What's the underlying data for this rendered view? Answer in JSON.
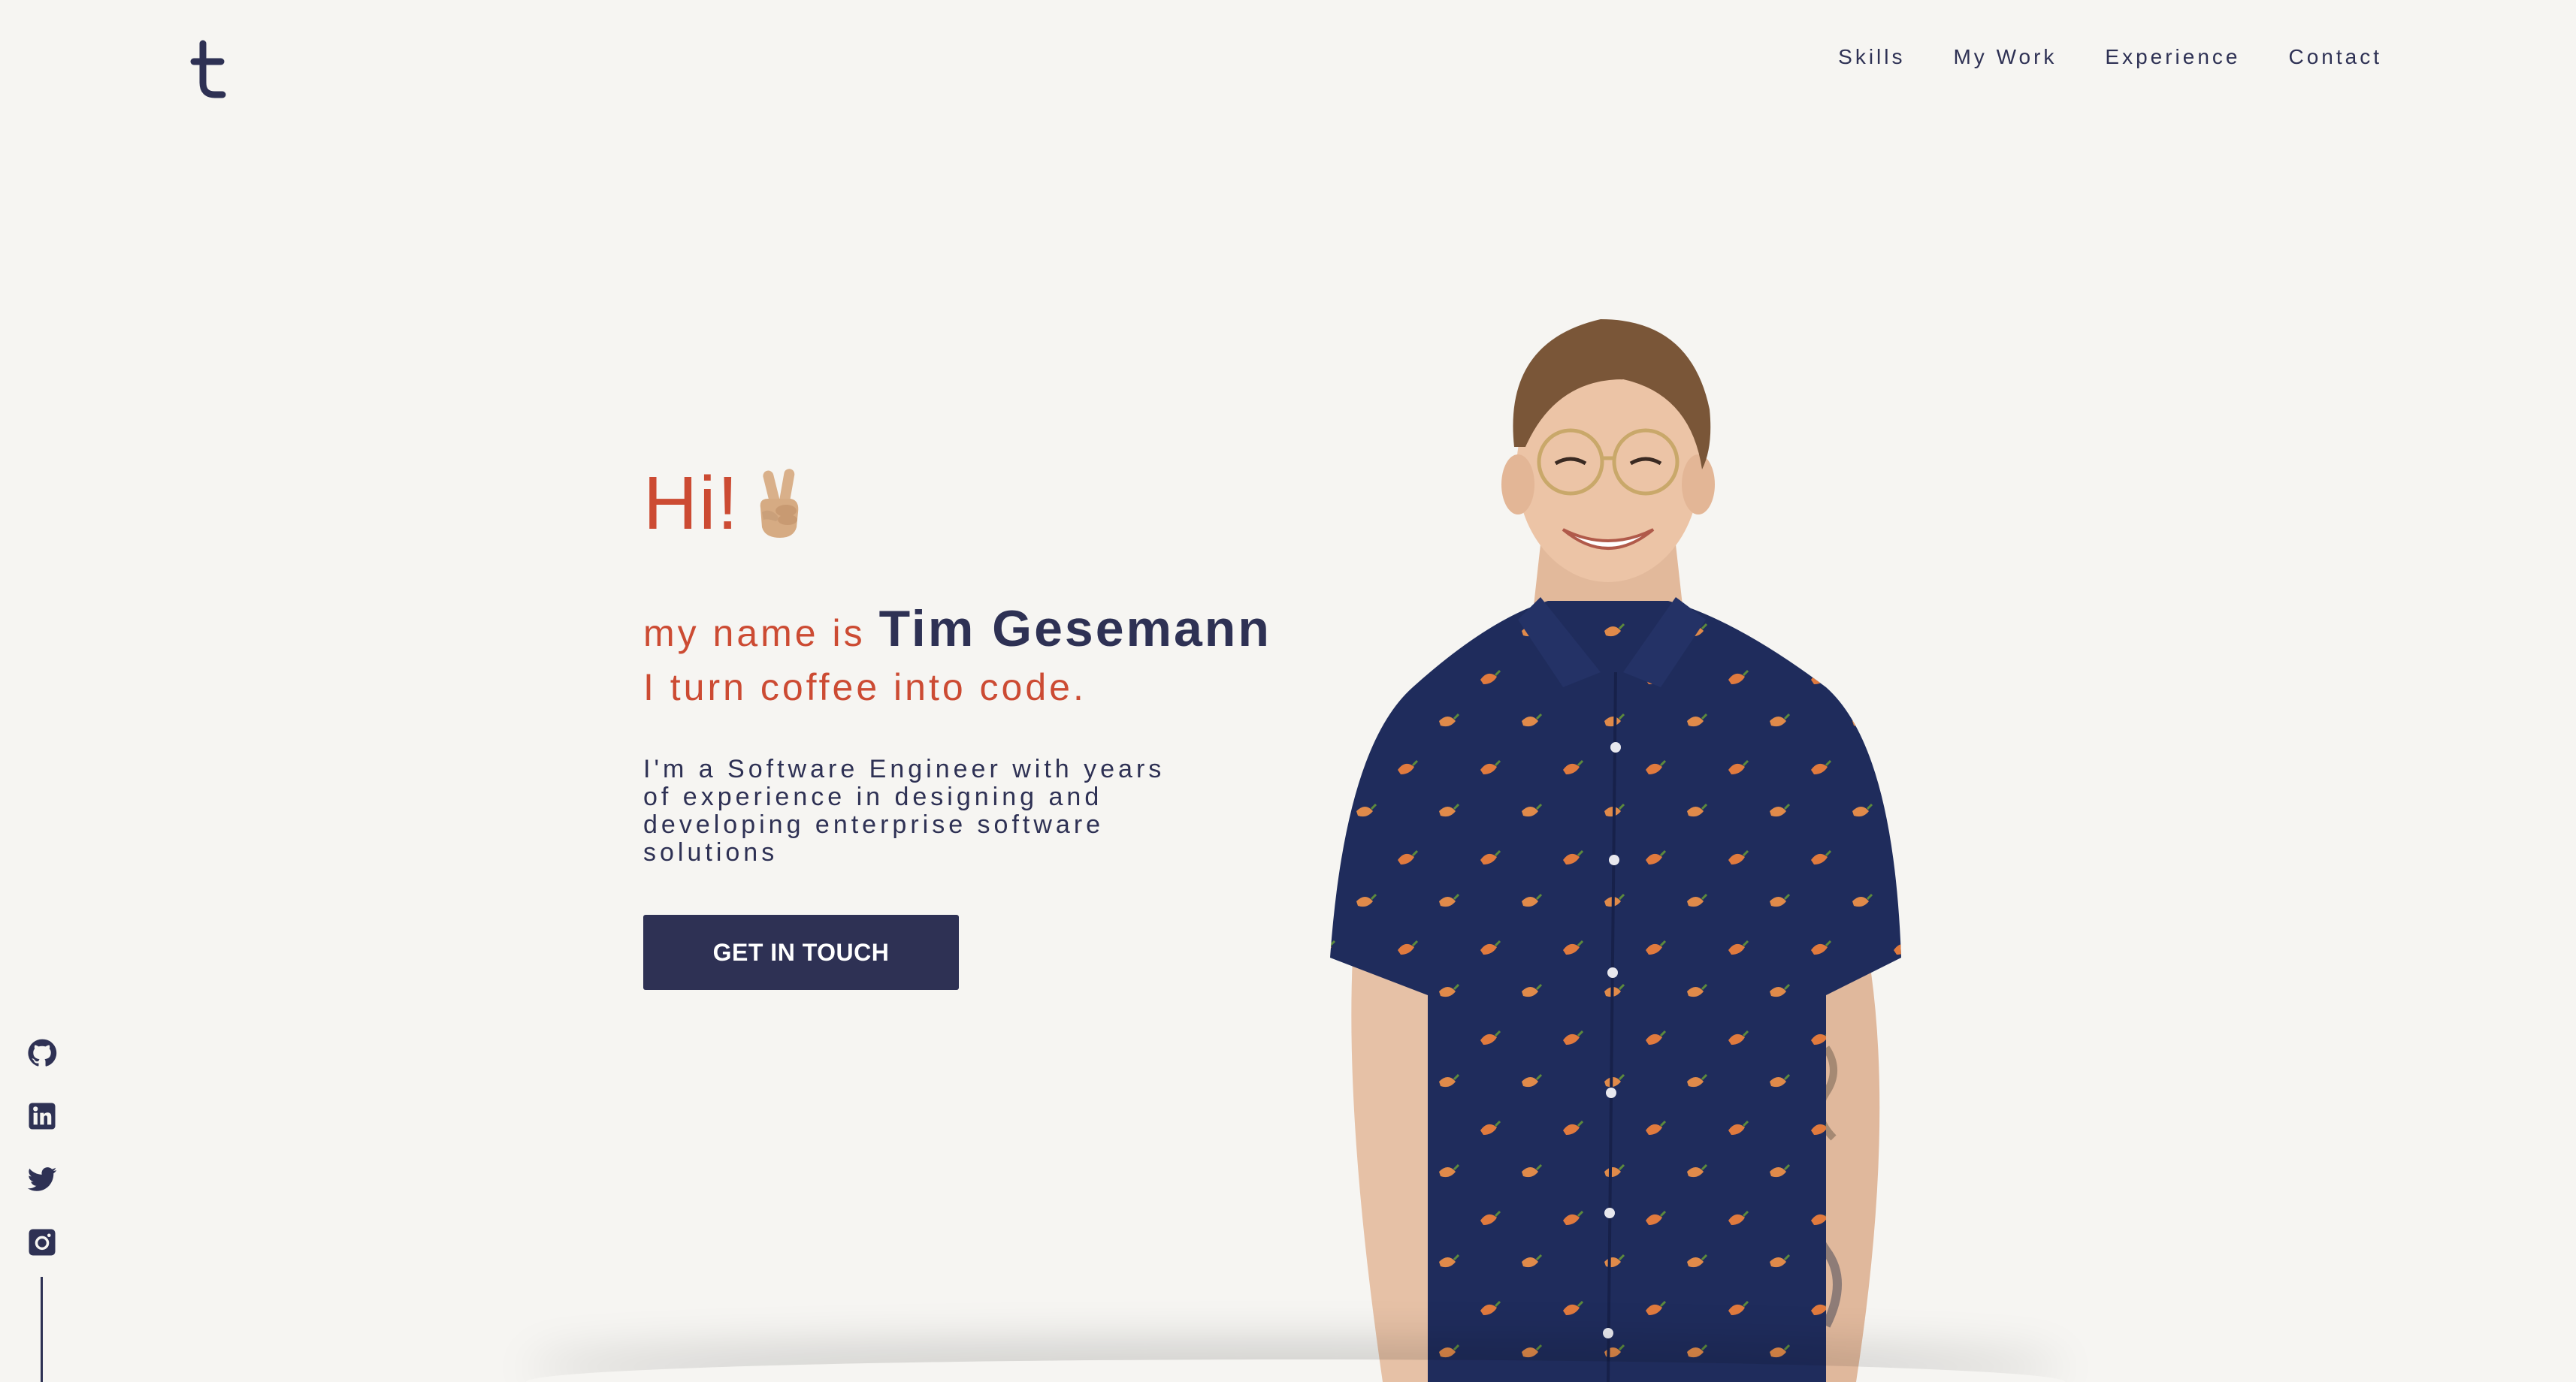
{
  "brand": {
    "logo_letter": "t",
    "colors": {
      "navy": "#2e3154",
      "accent": "#cc4b33",
      "background": "#f6f5f2"
    }
  },
  "nav": {
    "items": [
      {
        "label": "Skills"
      },
      {
        "label": "My Work"
      },
      {
        "label": "Experience"
      },
      {
        "label": "Contact"
      }
    ]
  },
  "hero": {
    "greeting": "Hi!",
    "greeting_emoji": "victory-hand-icon",
    "name_prefix": "my name is",
    "name": "Tim Gesemann",
    "tagline": "I turn coffee into code.",
    "bio": "I'm a Software Engineer with years of experience in designing and developing enterprise software solutions",
    "cta_label": "GET IN TOUCH"
  },
  "social": {
    "links": [
      {
        "icon": "github-icon"
      },
      {
        "icon": "linkedin-icon"
      },
      {
        "icon": "twitter-icon"
      },
      {
        "icon": "instagram-icon"
      }
    ]
  }
}
